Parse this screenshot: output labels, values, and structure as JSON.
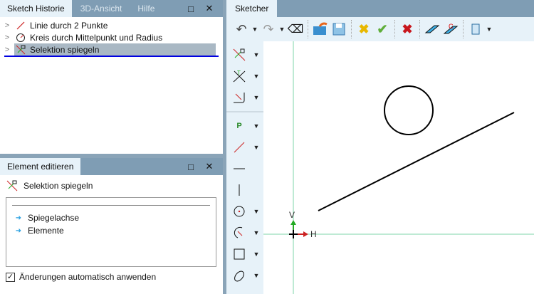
{
  "history_panel": {
    "tabs": [
      "Sketch Historie",
      "3D-Ansicht",
      "Hilfe"
    ],
    "maximize_icon": "□",
    "close_icon": "✕",
    "items": [
      {
        "label": "Linie durch 2 Punkte",
        "icon": "line-icon"
      },
      {
        "label": "Kreis durch Mittelpunkt und Radius",
        "icon": "circle-radius-icon"
      },
      {
        "label": "Selektion spiegeln",
        "icon": "mirror-icon",
        "selected": true
      }
    ]
  },
  "edit_panel": {
    "tab": "Element editieren",
    "title": "Selektion spiegeln",
    "fields": [
      "Spiegelachse",
      "Elemente"
    ],
    "auto_apply_label": "Änderungen automatisch anwenden",
    "auto_apply_checked": true
  },
  "sketcher": {
    "tab": "Sketcher",
    "axis_v": "V",
    "axis_h": "H"
  },
  "colors": {
    "tabbar": "#7f9db4",
    "panel_bg": "#e7f2f9",
    "axis": "#7ed6a8",
    "selection": "#a9b8c4",
    "underline": "#0000e0"
  }
}
